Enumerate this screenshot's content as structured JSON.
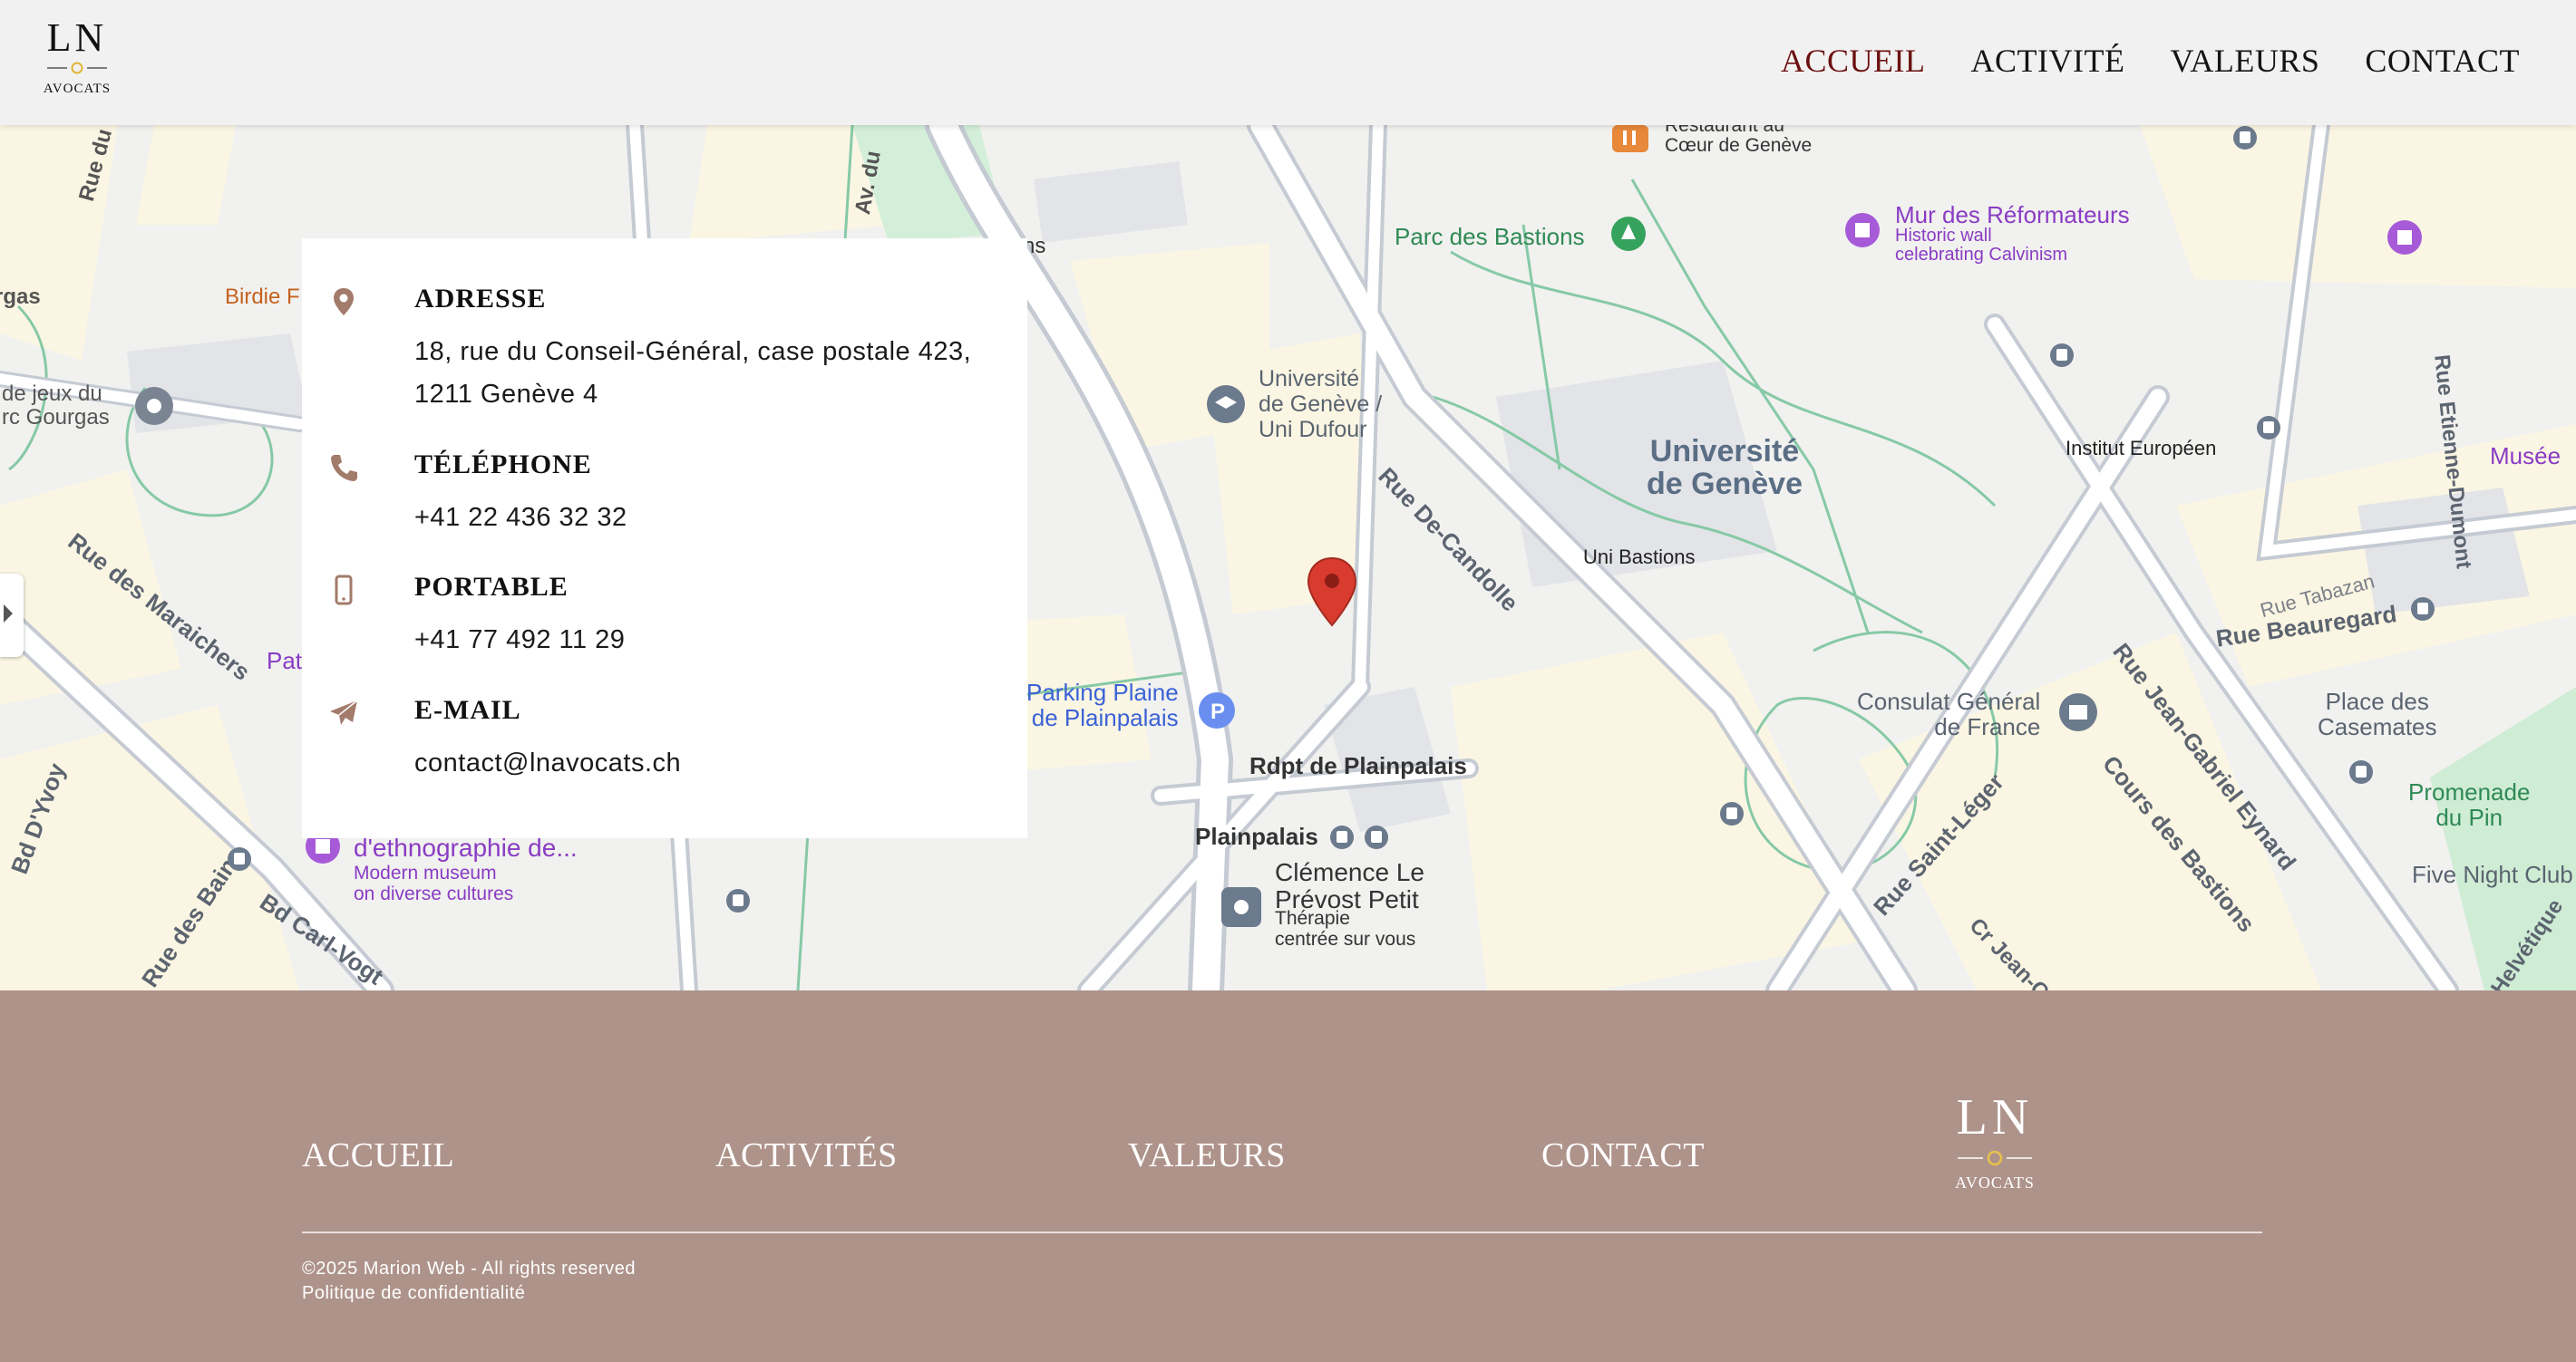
{
  "header": {
    "logo_main": "LN",
    "logo_sub": "AVOCATS",
    "nav": [
      {
        "label": "ACCUEIL",
        "active": true
      },
      {
        "label": "ACTIVITÉ"
      },
      {
        "label": "VALEURS"
      },
      {
        "label": "CONTACT"
      }
    ]
  },
  "map": {
    "labels": {
      "restaurant": "Restaurant au\nCœur de Genève",
      "parc_bastions": "Parc des Bastions",
      "mur_reformateurs": "Mur des Réformateurs",
      "mur_sub": "Historic wall\ncelebrating Calvinism",
      "birdie": "Birdie F",
      "jeux": "de jeux du\nrc Gourgas",
      "gas": "rgas",
      "village": "Rue du Village-S",
      "avenue": "Av. du",
      "ns": "ns",
      "uni_dufour": "Université\nde Genève /\nUni Dufour",
      "universite": "Université\nde Genève",
      "uni_bastions": "Uni Bastions",
      "institut": "Institut Européen",
      "musee": "Musée",
      "candolle": "Rue De-Candolle",
      "maraichers": "Rue des Maraichers",
      "pat": "Pat",
      "parking": "Parking Plaine\nde Plainpalais",
      "rdpt": "Rdpt de Plainpalais",
      "plainpalais": "Plainpalais",
      "clemence": "Clémence Le\nPrévost Petit",
      "therapie": "Thérapie\ncentrée sur vous",
      "ethno": "d'ethnographie de...",
      "ethno_sub": "Modern museum\non diverse cultures",
      "consulat": "Consulat Général\nde France",
      "place_casemates": "Place des\nCasemates",
      "promenade": "Promenade\ndu Pin",
      "five_night": "Five Night Club",
      "tabazan": "Rue Tabazan",
      "beauregard": "Rue Beauregard",
      "eynard": "Rue Jean-Gabriel Eynard",
      "cours_bastions": "Cours des Bastions",
      "saint_leger": "Rue Saint-Léger",
      "etienne": "Rue Etienne-Dumont",
      "dvvoy": "Bd D'Yvoy",
      "carl_vogt": "Bd Carl-Vogt",
      "bains": "Rue des Bains",
      "helvetique": "Helvétique",
      "cr_jean": "Cr Jean-C"
    }
  },
  "contact_card": {
    "items": [
      {
        "title": "ADRESSE",
        "value": "18, rue du Conseil-Général, case postale 423,\n1211 Genève 4",
        "icon": "map-pin-icon"
      },
      {
        "title": "TÉLÉPHONE",
        "value": "+41 22 436 32 32",
        "icon": "phone-icon"
      },
      {
        "title": "PORTABLE",
        "value": "+41 77 492 11 29",
        "icon": "mobile-icon"
      },
      {
        "title": "E-MAIL",
        "value": "contact@lnavocats.ch",
        "icon": "paper-plane-icon"
      }
    ]
  },
  "footer": {
    "nav": [
      "ACCUEIL",
      "ACTIVITÉS",
      "VALEURS",
      "CONTACT"
    ],
    "logo_main": "LN",
    "logo_sub": "AVOCATS",
    "copyright": "©2025 Marion Web - All rights reserved",
    "privacy": "Politique de confidentialité"
  },
  "colors": {
    "accent": "#6b1010",
    "footer_bg": "#ae938b",
    "icon_color": "#a27b6b",
    "map_pin": "#d93b2f"
  }
}
